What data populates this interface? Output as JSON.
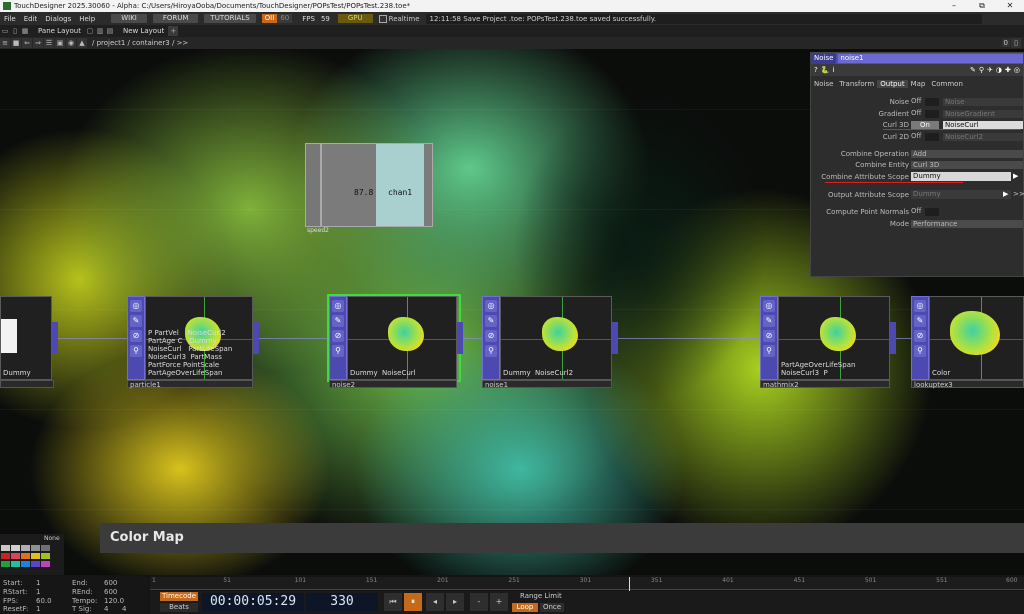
{
  "window": {
    "title": "TouchDesigner 2025.30060 - Alpha: C:/Users/HiroyaOoba/Documents/TouchDesigner/POPsTest/POPsTest.238.toe*",
    "minimize": "–",
    "maximize": "⧉",
    "close": "✕"
  },
  "menu": {
    "items": [
      "File",
      "Edit",
      "Dialogs",
      "Help"
    ],
    "wiki": "WIKI",
    "forum": "FORUM",
    "tutorials": "TUTORIALS",
    "oii": "OII",
    "n60": "60",
    "fps_label": "FPS",
    "fps_value": "59",
    "gpu": "GPU",
    "realtime": "Realtime",
    "status": "12:11:58 Save Project .toe: POPsTest.238.toe saved successfully."
  },
  "pane": {
    "pane_layout": "Pane Layout",
    "new_layout": "New Layout",
    "add": "+"
  },
  "path": {
    "path": "/ project1 / container3 / >>",
    "right_counter": "0"
  },
  "chan_box": {
    "value": "87.8",
    "channel": "chan1",
    "name": "speed2"
  },
  "nodes": [
    {
      "name": "particle1",
      "overlay": "P PartVel    NoiseCurl2\nPartAge C   Dummy\nNoiseCurl   PartLifeSpan\nNoiseCurl3  PartMass\nPartForce PointScale\nPartAgeOverLifeSpan"
    },
    {
      "name": "noise2",
      "overlay": "Dummy  NoiseCurl"
    },
    {
      "name": "noise1",
      "overlay": "Dummy  NoiseCurl2"
    },
    {
      "name": "mathmix2",
      "overlay": "PartAgeOverLifeSpan\nNoiseCurl3  P"
    },
    {
      "name": "lookuptex3",
      "overlay": "Color"
    }
  ],
  "left_node": {
    "overlay": "Dummy"
  },
  "params": {
    "op_type": "Noise",
    "op_name": "noise1",
    "tool_help": "?",
    "tool_info": "i",
    "tabs": [
      "Noise",
      "Transform",
      "Output",
      "Map",
      "Common"
    ],
    "active_tab": "Output",
    "rows": [
      {
        "label": "Noise",
        "toggle": "Off",
        "field": "Noise"
      },
      {
        "label": "Gradient",
        "toggle": "Off",
        "field": "NoiseGradient"
      },
      {
        "label": "Curl 3D",
        "toggle": "On",
        "field": "NoiseCurl"
      },
      {
        "label": "Curl 2D",
        "toggle": "Off",
        "field": "NoiseCurl2"
      }
    ],
    "combine_operation": {
      "label": "Combine Operation",
      "value": "Add"
    },
    "combine_entity": {
      "label": "Combine Entity",
      "value": "Curl 3D"
    },
    "combine_attr_scope": {
      "label": "Combine Attribute Scope",
      "value": "Dummy"
    },
    "output_attr_scope": {
      "label": "Output Attribute Scope",
      "value": "Dummy"
    },
    "compute_normals": {
      "label": "Compute Point Normals",
      "value": "Off"
    },
    "mode": {
      "label": "Mode",
      "value": "Performance"
    },
    "more": ">>"
  },
  "color_map": {
    "title": "Color Map"
  },
  "palette": {
    "none": "None",
    "colors": [
      "#c8c8c8",
      "#d0d0d0",
      "#b0b0b0",
      "#909090",
      "#707070",
      "#d02020",
      "#e04060",
      "#e07020",
      "#e0c020",
      "#a0c020",
      "#20a040",
      "#20c0a0",
      "#2080e0",
      "#6040d0",
      "#c040c0"
    ]
  },
  "stats": {
    "start_label": "Start:",
    "start": "1",
    "end_label": "End:",
    "end": "600",
    "rstart_label": "RStart:",
    "rstart": "1",
    "rend_label": "REnd:",
    "rend": "600",
    "fps_label": "FPS:",
    "fps": "60.0",
    "tempo_label": "Tempo:",
    "tempo": "120.0",
    "resetf_label": "ResetF:",
    "resetf": "1",
    "tsig_label": "T Sig:",
    "tsig_a": "4",
    "tsig_b": "4"
  },
  "timeline": {
    "ticks": [
      "1",
      "51",
      "101",
      "151",
      "201",
      "251",
      "301",
      "351",
      "401",
      "451",
      "501",
      "551",
      "600"
    ],
    "timecode": "Timecode",
    "beats": "Beats",
    "time": "00:00:05:29",
    "frame": "330",
    "btn_start": "⏮",
    "btn_pause": "⏸",
    "btn_back": "◂",
    "btn_fwd": "▸",
    "btn_minus": "-",
    "btn_plus": "+",
    "range_limit": "Range Limit",
    "loop": "Loop",
    "once": "Once"
  },
  "chart_data": null
}
